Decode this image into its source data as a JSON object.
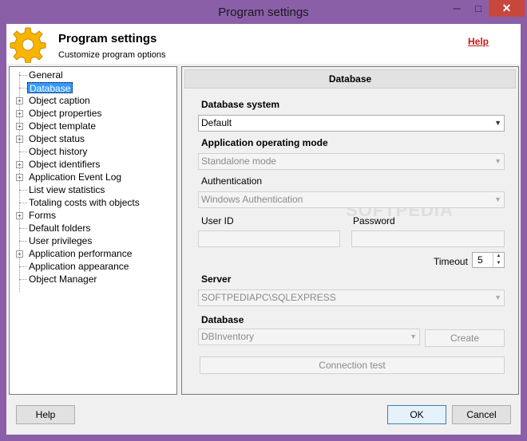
{
  "window": {
    "title": "Program settings",
    "min_icon": "minimize-icon",
    "max_icon": "maximize-icon",
    "close_icon": "close-icon"
  },
  "header": {
    "title": "Program settings",
    "subtitle": "Customize program options",
    "help_link": "Help",
    "icon": "gear-icon",
    "icon_color": "#f7b500"
  },
  "tree": {
    "items": [
      {
        "label": "General",
        "expandable": false
      },
      {
        "label": "Database",
        "expandable": false,
        "selected": true
      },
      {
        "label": "Object caption",
        "expandable": true
      },
      {
        "label": "Object properties",
        "expandable": true
      },
      {
        "label": "Object template",
        "expandable": true
      },
      {
        "label": "Object status",
        "expandable": true
      },
      {
        "label": "Object history",
        "expandable": false
      },
      {
        "label": "Object identifiers",
        "expandable": true
      },
      {
        "label": "Application Event Log",
        "expandable": true
      },
      {
        "label": "List view statistics",
        "expandable": false
      },
      {
        "label": "Totaling costs with objects",
        "expandable": false
      },
      {
        "label": "Forms",
        "expandable": true
      },
      {
        "label": "Default folders",
        "expandable": false
      },
      {
        "label": "User privileges",
        "expandable": false
      },
      {
        "label": "Application performance",
        "expandable": true
      },
      {
        "label": "Application appearance",
        "expandable": false
      },
      {
        "label": "Object Manager",
        "expandable": false
      }
    ]
  },
  "panel": {
    "title": "Database",
    "db_system_label": "Database system",
    "db_system_value": "Default",
    "mode_label": "Application operating mode",
    "mode_value": "Standalone mode",
    "auth_label": "Authentication",
    "auth_value": "Windows Authentication",
    "userid_label": "User ID",
    "password_label": "Password",
    "timeout_label": "Timeout",
    "timeout_value": "5",
    "server_label": "Server",
    "server_value": "SOFTPEDIAPC\\SQLEXPRESS",
    "database_label": "Database",
    "database_value": "DBInventory",
    "create_button": "Create",
    "connection_test_button": "Connection test",
    "watermark": "SOFTPEDIA"
  },
  "footer": {
    "help_button": "Help",
    "ok_button": "OK",
    "cancel_button": "Cancel"
  }
}
